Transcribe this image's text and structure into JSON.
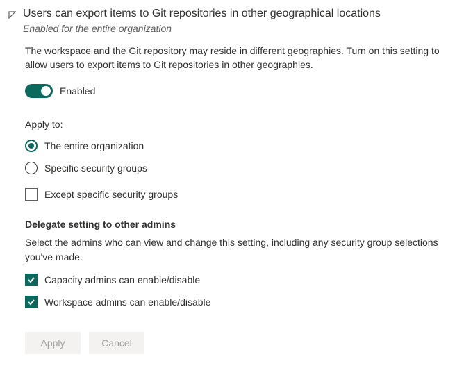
{
  "header": {
    "title": "Users can export items to Git repositories in other geographical locations",
    "subtitle": "Enabled for the entire organization",
    "description": "The workspace and the Git repository may reside in different geographies. Turn on this setting to allow users to export items to Git repositories in other geographies."
  },
  "toggle": {
    "label": "Enabled"
  },
  "applyTo": {
    "label": "Apply to:",
    "option1": "The entire organization",
    "option2": "Specific security groups",
    "except": "Except specific security groups"
  },
  "delegate": {
    "heading": "Delegate setting to other admins",
    "description": "Select the admins who can view and change this setting, including any security group selections you've made.",
    "capacity": "Capacity admins can enable/disable",
    "workspace": "Workspace admins can enable/disable"
  },
  "buttons": {
    "apply": "Apply",
    "cancel": "Cancel"
  }
}
